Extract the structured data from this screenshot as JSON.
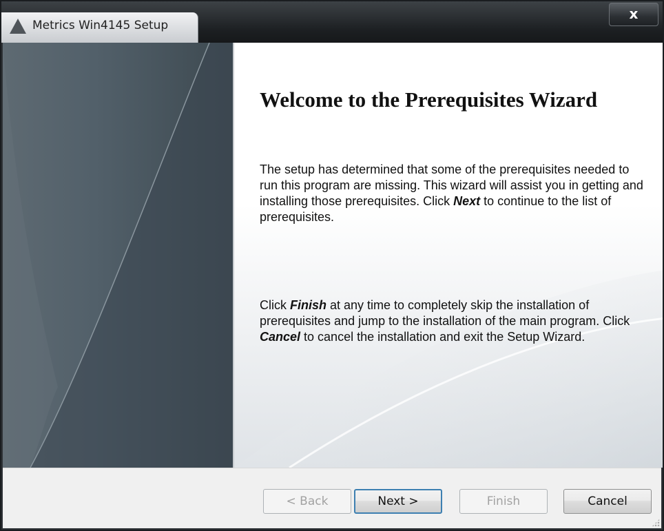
{
  "window": {
    "title": "Metrics Win4145 Setup",
    "close_glyph": "x",
    "app_icon": "warning-triangle-icon"
  },
  "content": {
    "heading": "Welcome to the Prerequisites Wizard",
    "para1_before": "The setup has determined that some of the prerequisites needed to run this program are missing. This wizard will assist you in getting and installing those prerequisites. Click ",
    "para1_next": "Next",
    "para1_after": "  to continue to the list of prerequisites.",
    "para2_a": "Click ",
    "para2_finish": "Finish",
    "para2_b": " at any time to completely skip the installation of prerequisites and jump to the installation of the main program. Click ",
    "para2_cancel": "Cancel",
    "para2_c": " to cancel the installation and exit the Setup Wizard."
  },
  "buttons": {
    "back": "< Back",
    "next": "Next >",
    "finish": "Finish",
    "cancel": "Cancel"
  },
  "colors": {
    "side_panel": "#52606a",
    "title_bar": "#1c1f22",
    "default_button_border": "#3c7fb1"
  }
}
